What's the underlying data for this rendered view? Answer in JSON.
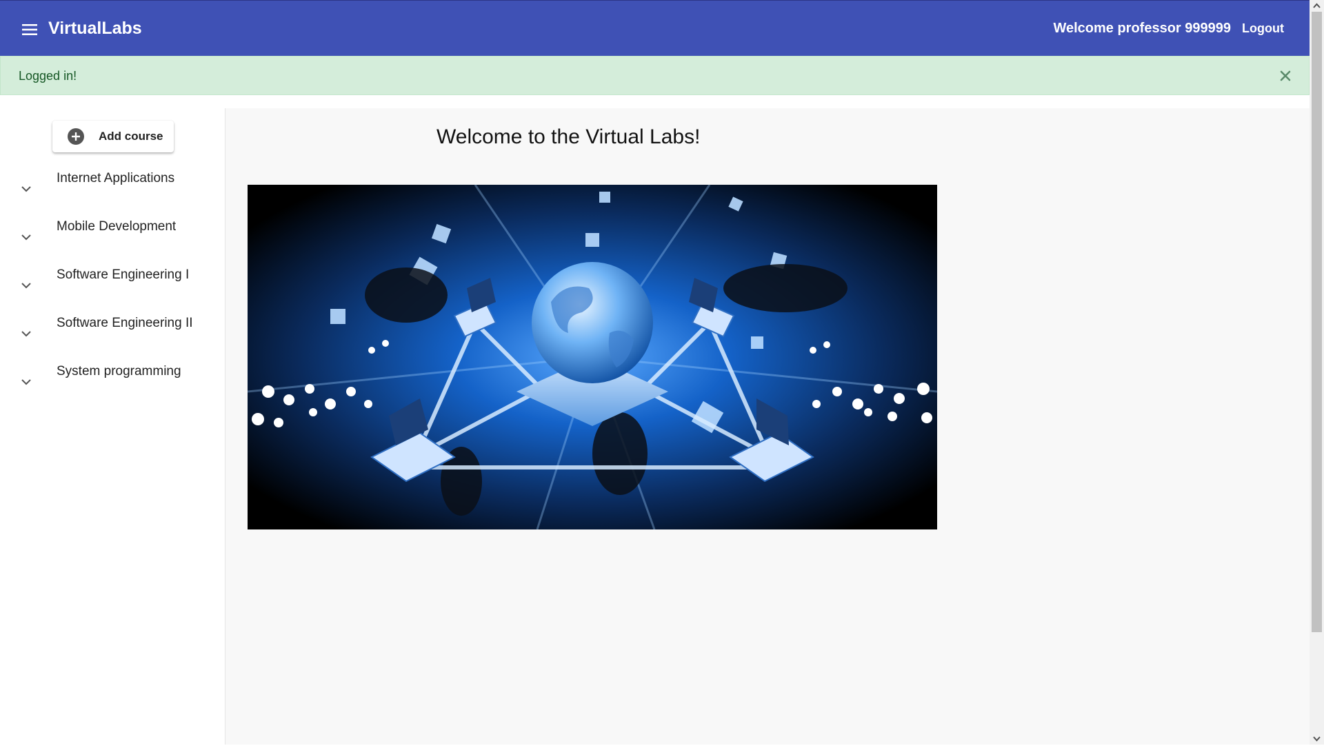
{
  "colors": {
    "toolbar_bg": "#3f51b5",
    "alert_bg": "#d4edda",
    "alert_text": "#155724",
    "main_bg": "#f8f8f8"
  },
  "toolbar": {
    "menu_icon": "hamburger-menu-icon",
    "title": "VirtualLabs",
    "welcome": "Welcome professor 999999",
    "logout_label": "Logout"
  },
  "alert": {
    "message": "Logged in!",
    "close_icon": "close-icon"
  },
  "sidebar": {
    "add_course_label": "Add course",
    "add_icon": "plus-circle-icon",
    "courses": [
      {
        "label": "Internet Applications"
      },
      {
        "label": "Mobile Development"
      },
      {
        "label": "Software Engineering I"
      },
      {
        "label": "Software Engineering II"
      },
      {
        "label": "System programming"
      }
    ]
  },
  "main": {
    "title": "Welcome to the Virtual Labs!",
    "hero_image": "globe-network-laptops-illustration"
  }
}
